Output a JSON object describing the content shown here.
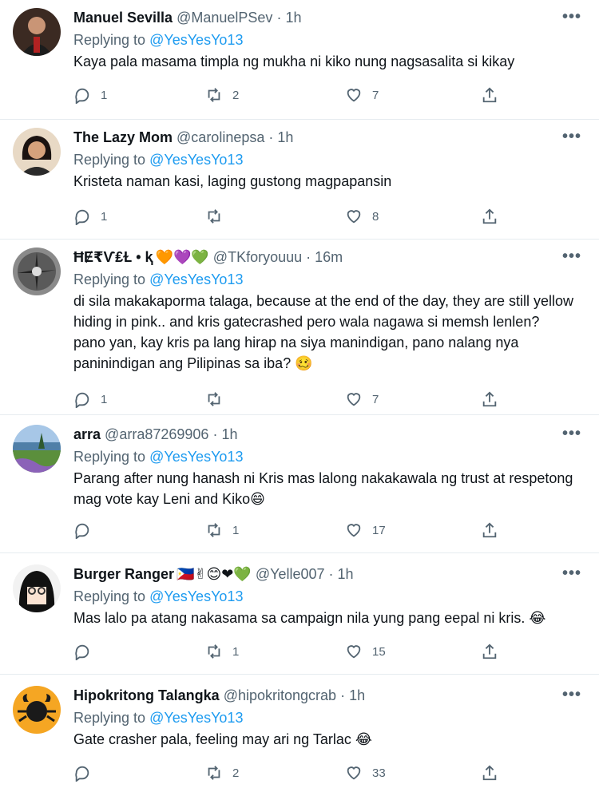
{
  "tweets": [
    {
      "name": "Manuel Sevilla",
      "emoji": "",
      "handle": "@ManuelPSev",
      "sep": "·",
      "time": "1h",
      "replying_prefix": "Replying to ",
      "replying_to": "@YesYesYo13",
      "text": "Kaya pala masama timpla ng mukha ni kiko nung nagsasalita si kikay",
      "replies": "1",
      "retweets": "2",
      "likes": "7"
    },
    {
      "name": "The Lazy Mom",
      "emoji": "",
      "handle": "@carolinepsa",
      "sep": "·",
      "time": "1h",
      "replying_prefix": "Replying to ",
      "replying_to": "@YesYesYo13",
      "text": "Kristeta naman kasi, laging gustong magpapansin",
      "replies": "1",
      "retweets": "",
      "likes": "8"
    },
    {
      "name": "ĦɆ₹Ѵ₤Ɫ • ⱪ",
      "emoji": "🧡💜💚",
      "handle": "@TKforyouuu",
      "sep": "·",
      "time": "16m",
      "replying_prefix": "Replying to ",
      "replying_to": "@YesYesYo13",
      "text": "di sila makakaporma talaga, because at the end of the day, they are still yellow hiding in pink.. and kris gatecrashed pero wala nagawa si memsh lenlen? pano yan, kay kris pa lang hirap na siya manindigan, pano nalang nya paninindigan ang Pilipinas sa iba? 🥴",
      "replies": "1",
      "retweets": "",
      "likes": "7"
    },
    {
      "name": "arra",
      "emoji": "",
      "handle": "@arra87269906",
      "sep": "·",
      "time": "1h",
      "replying_prefix": "Replying to ",
      "replying_to": "@YesYesYo13",
      "text": "Parang after nung hanash ni Kris mas lalong nakakawala ng trust at respetong mag vote kay Leni and Kiko😄",
      "replies": "",
      "retweets": "1",
      "likes": "17"
    },
    {
      "name": "Burger Ranger",
      "emoji": "🇵🇭✌😊❤💚",
      "handle": "@Yelle007",
      "sep": "·",
      "time": "1h",
      "replying_prefix": "Replying to ",
      "replying_to": "@YesYesYo13",
      "text": "Mas lalo pa atang nakasama sa campaign nila yung pang eepal ni kris. 😂",
      "replies": "",
      "retweets": "1",
      "likes": "15"
    },
    {
      "name": "Hipokritong Talangka",
      "emoji": "",
      "handle": "@hipokritongcrab",
      "sep": "·",
      "time": "1h",
      "replying_prefix": "Replying to ",
      "replying_to": "@YesYesYo13",
      "text": "Gate crasher pala, feeling may ari ng Tarlac 😂",
      "replies": "",
      "retweets": "2",
      "likes": "33"
    }
  ],
  "more_label": "•••",
  "icons": {
    "reply": "reply-icon",
    "retweet": "retweet-icon",
    "like": "heart-icon",
    "share": "share-icon",
    "more": "more-icon"
  },
  "colors": {
    "link": "#1d9bf0",
    "secondary": "#536471",
    "text": "#0f1419",
    "border": "#e6ecf0"
  }
}
